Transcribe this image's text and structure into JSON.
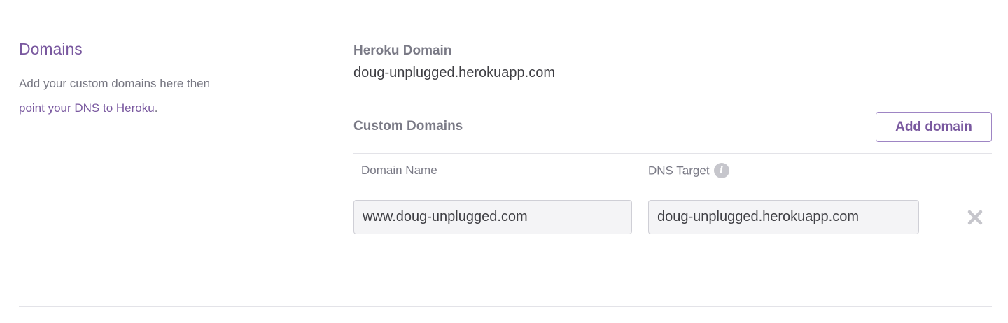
{
  "domains_section": {
    "title": "Domains",
    "description": "Add your custom domains here then",
    "dns_link_text": "point your DNS to Heroku",
    "description_suffix": "."
  },
  "heroku_domain": {
    "label": "Heroku Domain",
    "value": "doug-unplugged.herokuapp.com"
  },
  "custom_domains": {
    "label": "Custom Domains",
    "add_button_label": "Add domain",
    "columns": {
      "domain_name": "Domain Name",
      "dns_target": "DNS Target"
    },
    "rows": [
      {
        "domain_name": "www.doug-unplugged.com",
        "dns_target": "doug-unplugged.herokuapp.com"
      }
    ]
  },
  "icons": {
    "info": "info-icon",
    "remove": "close-icon"
  },
  "colors": {
    "accent": "#79589f",
    "muted_text": "#7a7a86",
    "border": "#e3e3e8"
  }
}
